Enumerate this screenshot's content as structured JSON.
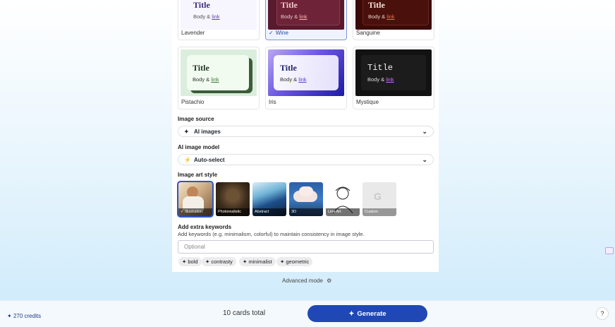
{
  "themes": [
    {
      "name": "Lavender",
      "title": "Title",
      "body": "Body &",
      "link": "link"
    },
    {
      "name": "Wine",
      "title": "Title",
      "body": "Body &",
      "link": "link",
      "selected": true
    },
    {
      "name": "Sanguine",
      "title": "Title",
      "body": "Body &",
      "link": "link"
    },
    {
      "name": "Pistachio",
      "title": "Title",
      "body": "Body &",
      "link": "link"
    },
    {
      "name": "Iris",
      "title": "Title",
      "body": "Body &",
      "link": "link"
    },
    {
      "name": "Mystique",
      "title": "Title",
      "body": "Body &",
      "link": "link"
    }
  ],
  "check_glyph": "✓",
  "image_source": {
    "label": "Image source",
    "value": "AI images"
  },
  "ai_model": {
    "label": "AI image model",
    "value": "Auto-select"
  },
  "art_style": {
    "label": "Image art style",
    "options": [
      "Illustration",
      "Photorealistic",
      "Abstract",
      "3D",
      "Line Art",
      "Custom"
    ],
    "selected_index": 0
  },
  "keywords": {
    "label": "Add extra keywords",
    "hint": "Add keywords (e.g. minimalism, colorful) to maintain consistency in image style.",
    "placeholder": "Optional",
    "chips": [
      "bold",
      "contrasty",
      "minimalist",
      "geometric"
    ]
  },
  "advanced_mode": "Advanced mode",
  "footer": {
    "credits": "270 credits",
    "cards_total": "10 cards total",
    "generate": "Generate",
    "help": "?"
  },
  "colors": {
    "accent": "#1f48b5",
    "selected_border": "#7d96d8"
  }
}
